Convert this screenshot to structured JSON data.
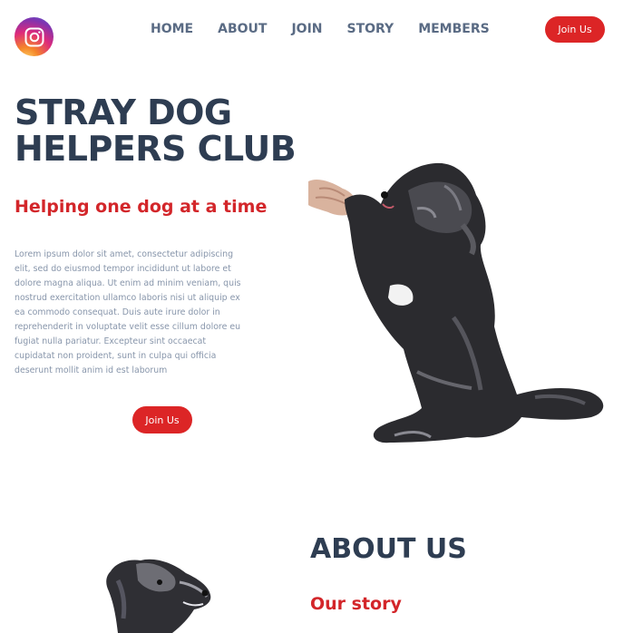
{
  "header": {
    "logo_icon": "instagram-icon",
    "nav": [
      {
        "label": "HOME"
      },
      {
        "label": "ABOUT"
      },
      {
        "label": "JOIN"
      },
      {
        "label": "STORY"
      },
      {
        "label": "MEMBERS"
      }
    ],
    "cta_label": "Join Us"
  },
  "hero": {
    "title": "STRAY DOG HELPERS CLUB",
    "subtitle": "Helping one dog at a time",
    "body": "Lorem ipsum dolor sit amet, consectetur adipiscing elit, sed do eiusmod tempor incididunt ut labore et dolore magna aliqua. Ut enim ad minim veniam, quis nostrud exercitation ullamco laboris nisi ut aliquip ex ea commodo consequat. Duis aute irure dolor in reprehenderit in voluptate velit esse cillum dolore eu fugiat nulla pariatur. Excepteur sint occaecat cupidatat non proident, sunt in culpa qui officia deserunt mollit anim id est laborum",
    "cta_label": "Join Us"
  },
  "about": {
    "title": "ABOUT US",
    "subtitle": "Our story"
  },
  "colors": {
    "accent": "#dc2526",
    "heading": "#2e3d52",
    "nav_text": "#5a6b84",
    "body_text": "#8896ab"
  }
}
